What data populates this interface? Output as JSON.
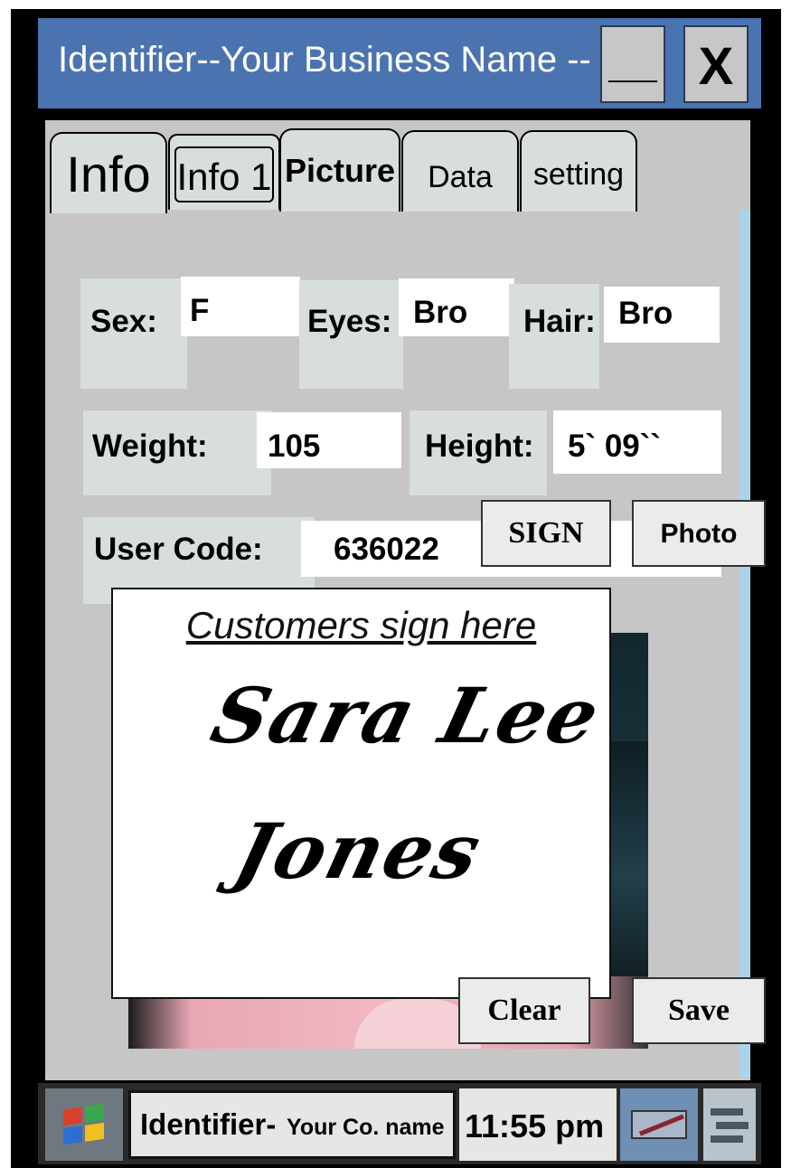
{
  "window": {
    "title": "Identifier--Your Business Name --",
    "minimize_label": "__",
    "close_label": "X"
  },
  "tabs": [
    "Info",
    "Info 1",
    "Picture",
    "Data",
    "setting"
  ],
  "form": {
    "sex_label": "Sex:",
    "sex_value": "F",
    "eyes_label": "Eyes:",
    "eyes_value": "Bro",
    "hair_label": "Hair:",
    "hair_value": "Bro",
    "weight_label": "Weight:",
    "weight_value": "105",
    "height_label": "Height:",
    "height_value": "5` 09``",
    "usercode_label": "User Code:",
    "usercode_value": "636022"
  },
  "buttons": {
    "sign": "SIGN",
    "photo": "Photo",
    "clear": "Clear",
    "save": "Save"
  },
  "signature": {
    "prompt": "Customers sign here",
    "line1": "Sara Lee",
    "line2": "Jones"
  },
  "taskbar": {
    "app_name": "Identifier-",
    "app_sub": "Your Co. name",
    "time": "11:55 pm"
  },
  "icons": [
    "windows-logo-icon",
    "pen-input-icon",
    "keyboard-menu-icon"
  ],
  "colors": {
    "titlebar": "#4a73b0",
    "panel": "#c6c6c6",
    "field": "#d8dedc"
  }
}
